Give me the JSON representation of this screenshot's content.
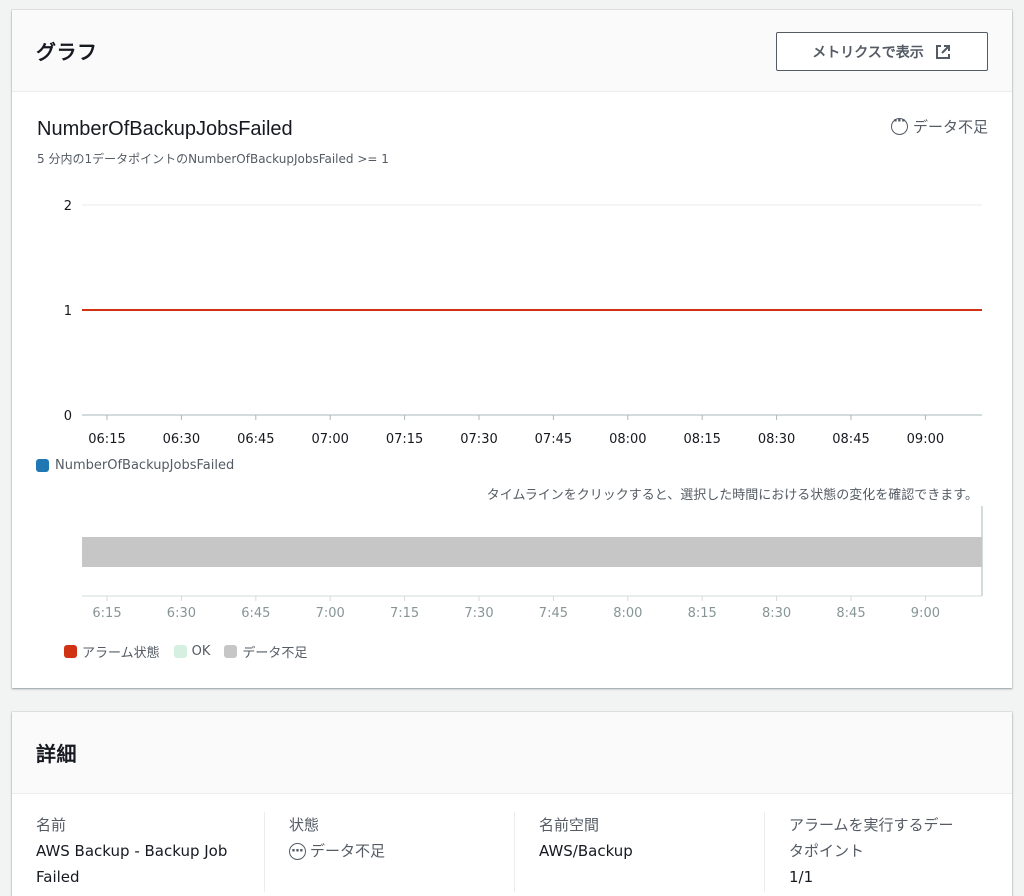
{
  "graph": {
    "header_title": "グラフ",
    "metrics_button_label": "メトリクスで表示",
    "chart_title": "NumberOfBackupJobsFailed",
    "chart_subtitle": "5 分内の1データポイントのNumberOfBackupJobsFailed >= 1",
    "state_label": "データ不足",
    "legend_metric": "NumberOfBackupJobsFailed",
    "timeline_hint": "タイムラインをクリックすると、選択した時間における状態の変化を確認できます。",
    "legend_alarm": "アラーム状態",
    "legend_ok": "OK",
    "legend_insufficient": "データ不足",
    "colors": {
      "metric": "#1f77b4",
      "threshold": "#d13212",
      "alarm": "#d13212",
      "ok": "#d5f0e0",
      "insufficient": "#c6c6c6"
    }
  },
  "chart_data": [
    {
      "type": "line",
      "title": "NumberOfBackupJobsFailed",
      "subtitle": "5 分内の1データポイントのNumberOfBackupJobsFailed >= 1",
      "x_ticks": [
        "06:15",
        "06:30",
        "06:45",
        "07:00",
        "07:15",
        "07:30",
        "07:45",
        "08:00",
        "08:15",
        "08:30",
        "08:45",
        "09:00"
      ],
      "y_ticks": [
        "0",
        "1",
        "2"
      ],
      "ylim": [
        0,
        2
      ],
      "series": [
        {
          "name": "NumberOfBackupJobsFailed",
          "values": []
        }
      ],
      "threshold": {
        "value": 1,
        "color": "#d13212"
      },
      "legend": "bottom-left",
      "grid": true
    },
    {
      "type": "area",
      "x_ticks": [
        "6:15",
        "6:30",
        "6:45",
        "7:00",
        "7:15",
        "7:30",
        "7:45",
        "8:00",
        "8:15",
        "8:30",
        "8:45",
        "9:00"
      ],
      "state": "データ不足",
      "legend": [
        "アラーム状態",
        "OK",
        "データ不足"
      ]
    }
  ],
  "details": {
    "header_title": "詳細",
    "name_label": "名前",
    "name_value_line1": "AWS Backup - Backup Job",
    "name_value_line2": "Failed",
    "state_label": "状態",
    "state_value": "データ不足",
    "namespace_label": "名前空間",
    "namespace_value": "AWS/Backup",
    "datapoints_label_line1": "アラームを実行するデー",
    "datapoints_label_line2": "タポイント",
    "datapoints_value": "1/1"
  }
}
